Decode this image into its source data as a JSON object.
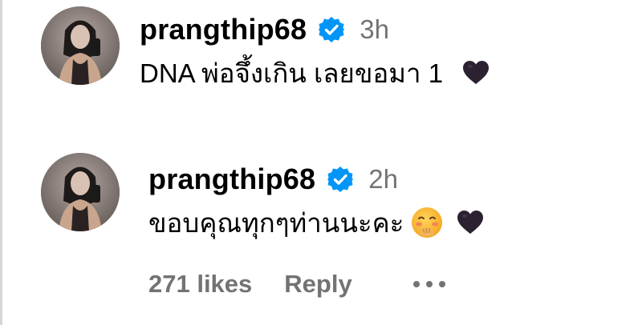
{
  "comments": [
    {
      "username": "prangthip68",
      "time": "3h",
      "text": "DNA พ่อจึ้งเกิน เลยขอมา 1",
      "avatar_icon": "user-avatar-photo",
      "verified_icon": "verified-badge-icon",
      "trailing_icons": [
        "black-heart-icon"
      ]
    },
    {
      "username": "prangthip68",
      "time": "2h",
      "text": "ขอบคุณทุกๆท่านนะคะ",
      "avatar_icon": "user-avatar-photo",
      "verified_icon": "verified-badge-icon",
      "trailing_icons": [
        "blushing-face-emoji-icon",
        "black-heart-icon"
      ],
      "actions": {
        "likes": "271 likes",
        "reply": "Reply",
        "more_icon": "more-options-icon"
      }
    }
  ],
  "colors": {
    "verified_blue": "#0095f6",
    "secondary_text": "#737373",
    "heart": "#2b2130"
  }
}
